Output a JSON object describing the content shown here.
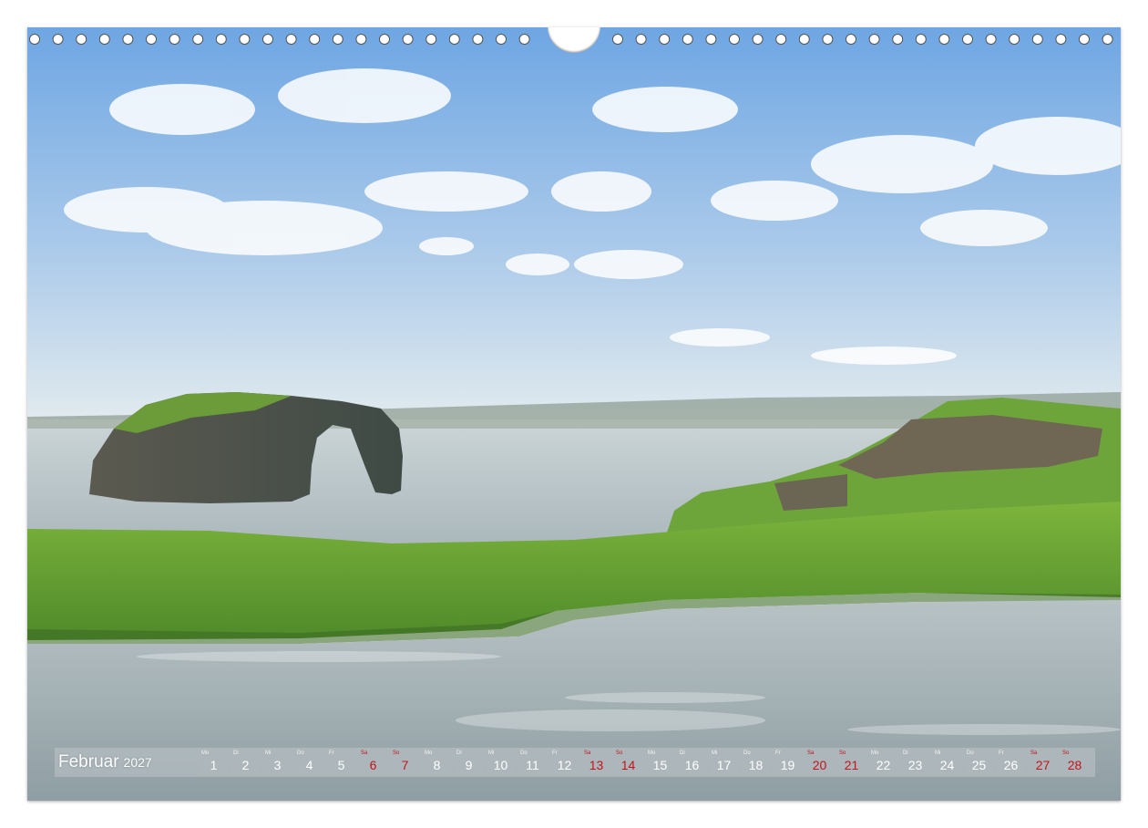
{
  "calendar": {
    "month": "Februar",
    "year": "2027",
    "days": [
      {
        "wd": "Mo",
        "num": "1",
        "weekend": false
      },
      {
        "wd": "Di",
        "num": "2",
        "weekend": false
      },
      {
        "wd": "Mi",
        "num": "3",
        "weekend": false
      },
      {
        "wd": "Do",
        "num": "4",
        "weekend": false
      },
      {
        "wd": "Fr",
        "num": "5",
        "weekend": false
      },
      {
        "wd": "Sa",
        "num": "6",
        "weekend": true
      },
      {
        "wd": "So",
        "num": "7",
        "weekend": true
      },
      {
        "wd": "Mo",
        "num": "8",
        "weekend": false
      },
      {
        "wd": "Di",
        "num": "9",
        "weekend": false
      },
      {
        "wd": "Mi",
        "num": "10",
        "weekend": false
      },
      {
        "wd": "Do",
        "num": "11",
        "weekend": false
      },
      {
        "wd": "Fr",
        "num": "12",
        "weekend": false
      },
      {
        "wd": "Sa",
        "num": "13",
        "weekend": true
      },
      {
        "wd": "So",
        "num": "14",
        "weekend": true
      },
      {
        "wd": "Mo",
        "num": "15",
        "weekend": false
      },
      {
        "wd": "Di",
        "num": "16",
        "weekend": false
      },
      {
        "wd": "Mi",
        "num": "17",
        "weekend": false
      },
      {
        "wd": "Do",
        "num": "18",
        "weekend": false
      },
      {
        "wd": "Fr",
        "num": "19",
        "weekend": false
      },
      {
        "wd": "Sa",
        "num": "20",
        "weekend": true
      },
      {
        "wd": "So",
        "num": "21",
        "weekend": true
      },
      {
        "wd": "Mo",
        "num": "22",
        "weekend": false
      },
      {
        "wd": "Di",
        "num": "23",
        "weekend": false
      },
      {
        "wd": "Mi",
        "num": "24",
        "weekend": false
      },
      {
        "wd": "Do",
        "num": "25",
        "weekend": false
      },
      {
        "wd": "Fr",
        "num": "26",
        "weekend": false
      },
      {
        "wd": "Sa",
        "num": "27",
        "weekend": true
      },
      {
        "wd": "So",
        "num": "28",
        "weekend": true
      }
    ]
  },
  "colors": {
    "weekend": "#c2141c",
    "sky_top": "#7fb0e6",
    "sky_horizon": "#dde8ee",
    "grass": "#6aa536",
    "water": "#a9b6bc"
  },
  "photo": {
    "subject": "sea-arch-landscape"
  }
}
